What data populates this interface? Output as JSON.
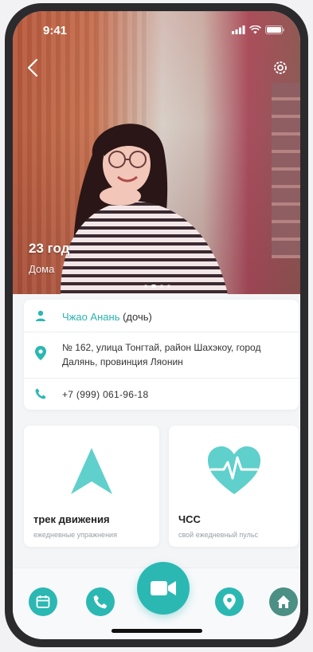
{
  "status": {
    "time": "9:41"
  },
  "profile": {
    "age": "23 год",
    "location": "Дома",
    "name": "Чжао Анань",
    "relation": "(дочь)",
    "address": "№ 162, улица Тонгтай, район Шахэкоу, город Далянь, провинция Ляонин",
    "phone": "+7 (999) 061-96-18"
  },
  "features": [
    {
      "title": "трек движения",
      "subtitle": "ежедневные упражнения",
      "icon": "navigation-arrow-icon"
    },
    {
      "title": "ЧСС",
      "subtitle": "свой ежедневный пульс",
      "icon": "heart-rate-icon"
    }
  ],
  "nav": [
    "calendar-icon",
    "phone-icon",
    "video-camera-icon",
    "location-pin-icon",
    "home-icon"
  ],
  "colors": {
    "accent": "#2bb8b3",
    "home": "#4c8f84",
    "name": "#28b3b0"
  }
}
